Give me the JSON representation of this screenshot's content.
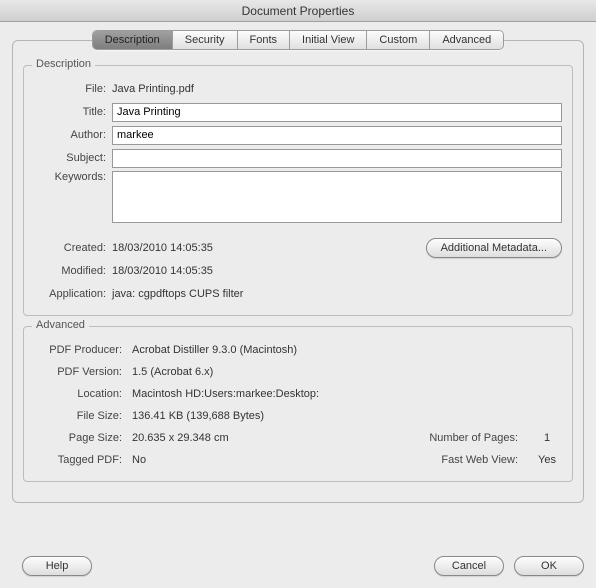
{
  "window": {
    "title": "Document Properties"
  },
  "tabs": {
    "description": "Description",
    "security": "Security",
    "fonts": "Fonts",
    "initial_view": "Initial View",
    "custom": "Custom",
    "advanced": "Advanced"
  },
  "description": {
    "group_label": "Description",
    "labels": {
      "file": "File:",
      "title": "Title:",
      "author": "Author:",
      "subject": "Subject:",
      "keywords": "Keywords:",
      "created": "Created:",
      "modified": "Modified:",
      "application": "Application:"
    },
    "file": "Java Printing.pdf",
    "title": "Java Printing",
    "author": "markee",
    "subject": "",
    "keywords": "",
    "created": "18/03/2010 14:05:35",
    "modified": "18/03/2010 14:05:35",
    "application": "java: cgpdftops CUPS filter",
    "additional_metadata_btn": "Additional Metadata..."
  },
  "advanced": {
    "group_label": "Advanced",
    "labels": {
      "producer": "PDF Producer:",
      "version": "PDF Version:",
      "location": "Location:",
      "file_size": "File Size:",
      "page_size": "Page Size:",
      "num_pages": "Number of Pages:",
      "tagged": "Tagged PDF:",
      "fast_web": "Fast Web View:"
    },
    "producer": "Acrobat Distiller 9.3.0 (Macintosh)",
    "version": "1.5 (Acrobat 6.x)",
    "location": "Macintosh HD:Users:markee:Desktop:",
    "file_size": "136.41 KB (139,688 Bytes)",
    "page_size": "20.635 x 29.348 cm",
    "num_pages": "1",
    "tagged": "No",
    "fast_web": "Yes"
  },
  "buttons": {
    "help": "Help",
    "cancel": "Cancel",
    "ok": "OK"
  }
}
